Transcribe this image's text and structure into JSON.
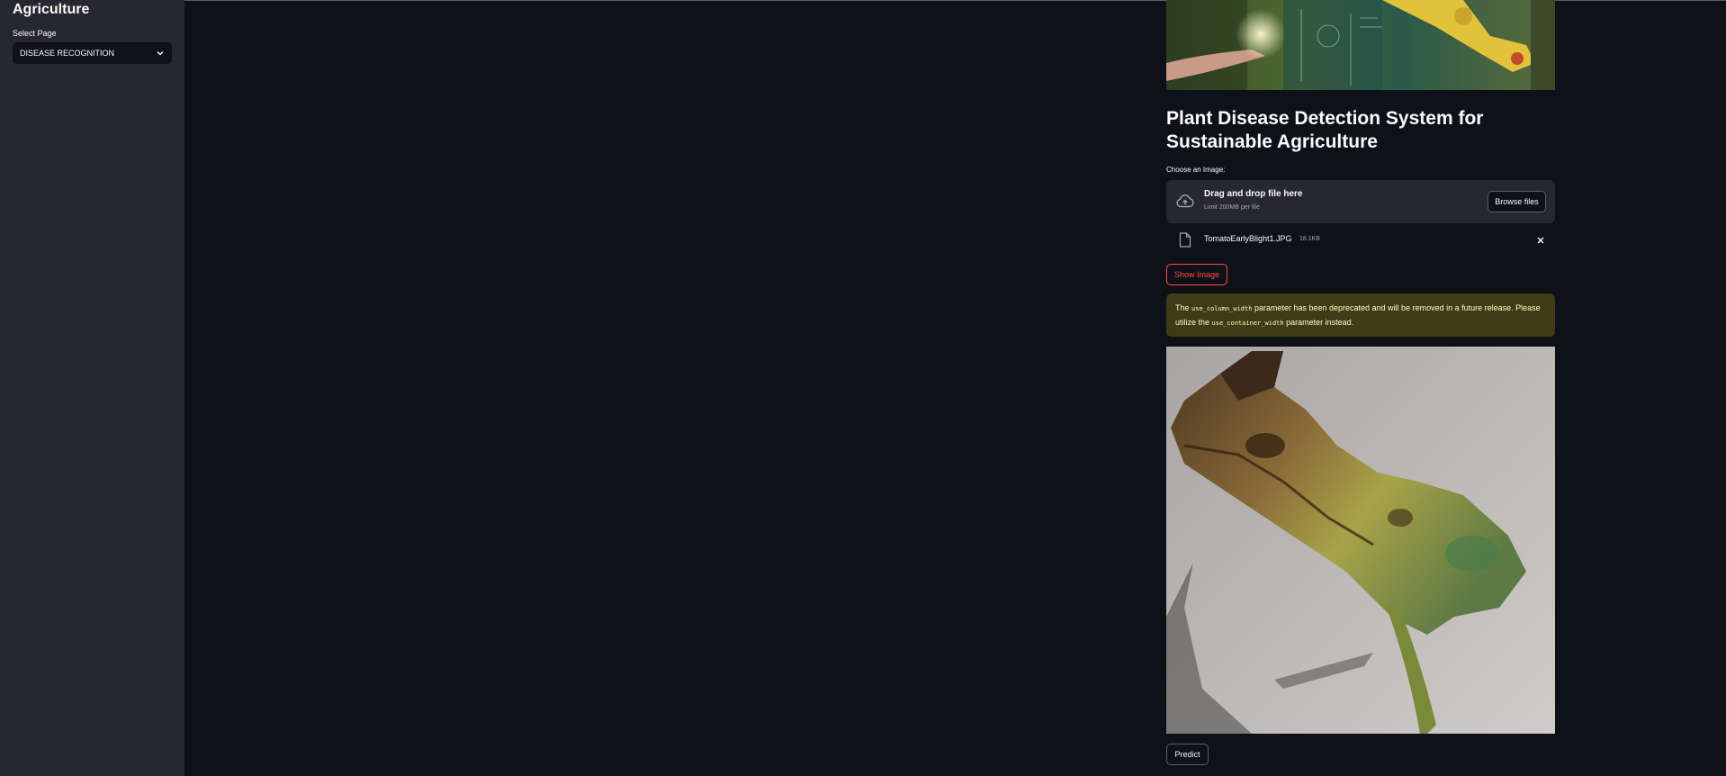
{
  "sidebar": {
    "title": "Agriculture",
    "select_label": "Select Page",
    "select_value": "DISEASE RECOGNITION"
  },
  "main": {
    "title": "Plant Disease Detection System for Sustainable Agriculture",
    "uploader_label": "Choose an Image:",
    "dropzone_text": "Drag and drop file here",
    "dropzone_limit": "Limit 200MB per file",
    "browse_label": "Browse files",
    "file_name": "TomatoEarlyBlight1.JPG",
    "file_size": "18.1KB",
    "show_image_label": "Show Image",
    "warning": {
      "p1": "The ",
      "code1": "use_column_width",
      "p2": " parameter has been deprecated and will be removed in a future release. Please utilize the ",
      "code2": "use_container_width",
      "p3": " parameter instead."
    },
    "predict_label": "Predict"
  },
  "colors": {
    "app_bg": "#0e1117",
    "sidebar_bg": "#262730",
    "accent": "#ff4b4b",
    "warning_bg": "#3e3b16",
    "warning_text": "#ffffc2"
  },
  "icons": [
    "chevron-down-icon",
    "cloud-upload-icon",
    "file-icon",
    "close-icon"
  ]
}
